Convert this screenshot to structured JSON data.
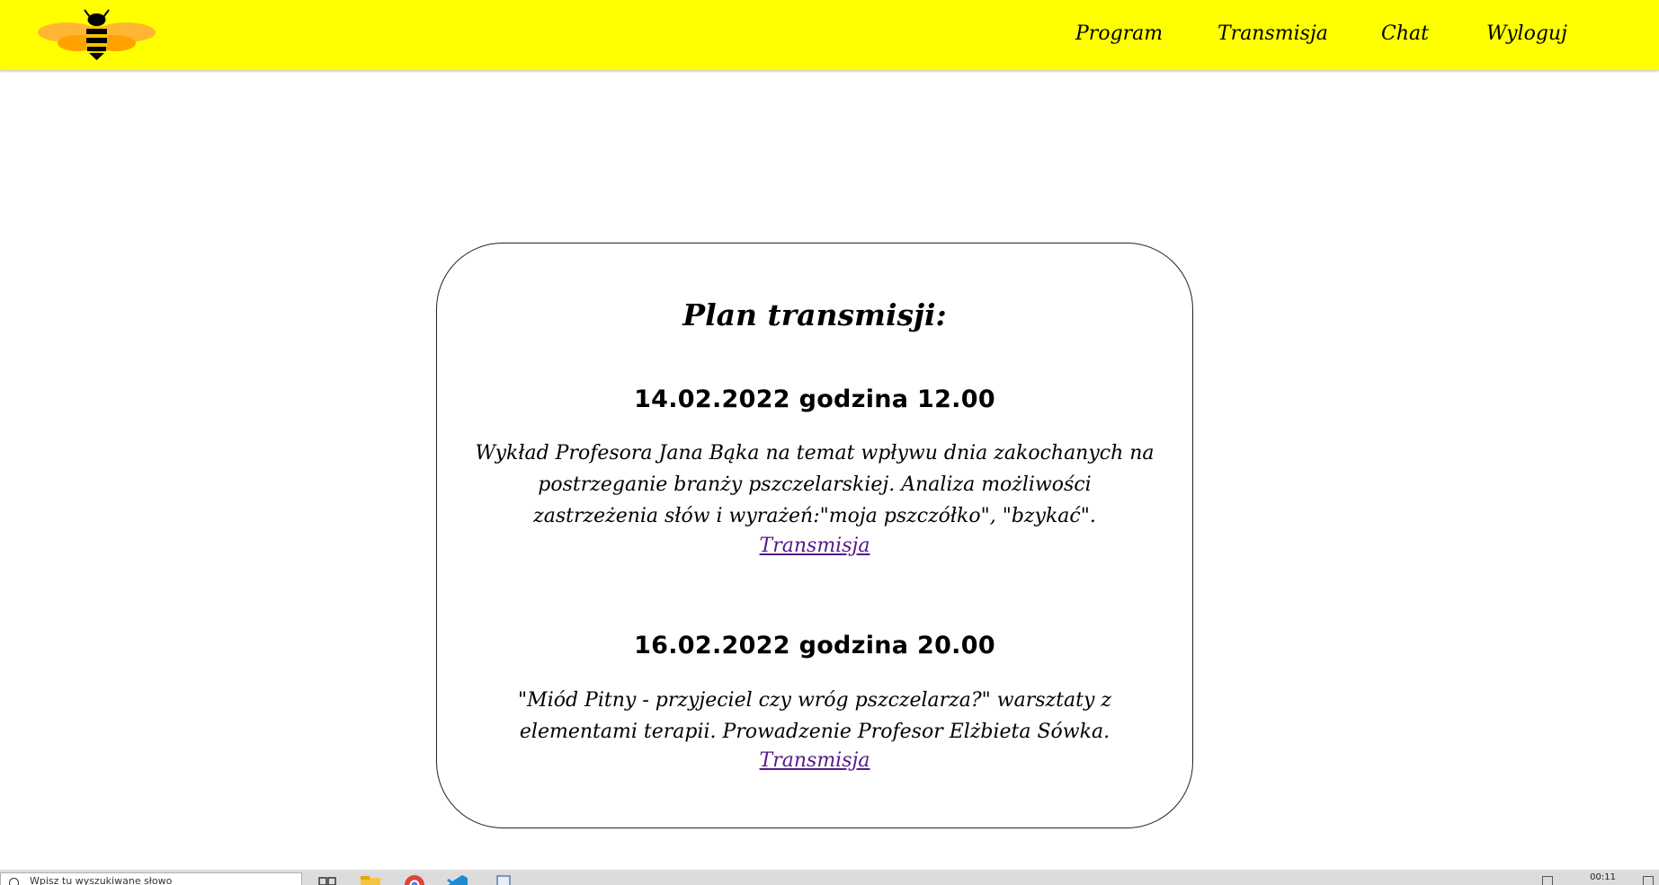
{
  "header": {
    "logo": "bee-logo",
    "nav": {
      "program": "Program",
      "transmisja": "Transmisja",
      "chat": "Chat",
      "logout": "Wyloguj"
    },
    "colors": {
      "background": "#ffff00",
      "text": "#000000"
    }
  },
  "card": {
    "title": "Plan transmisji:",
    "events": [
      {
        "date": "14.02.2022 godzina 12.00",
        "description": "Wykład Profesora Jana Bąka na temat wpływu dnia zakochanych na postrzeganie branży pszczelarskiej. Analiza możliwości zastrzeżenia słów i wyrażeń:\"moja pszczółko\", \"bzykać\".",
        "link": "Transmisja"
      },
      {
        "date": "16.02.2022 godzina 20.00",
        "description": "\"Miód Pitny - przyjeciel czy wróg pszczelarza?\" warsztaty z elementami terapii. Prowadzenie Profesor Elżbieta Sówka.",
        "link": "Transmisja"
      }
    ],
    "colors": {
      "link": "#551a8b"
    }
  },
  "taskbar": {
    "search_placeholder": "Wpisz tu wyszukiwane słowo",
    "clock": "00:11",
    "icons": [
      "task-view-icon",
      "file-explorer-icon",
      "chrome-icon",
      "vscode-icon",
      "document-icon"
    ]
  }
}
